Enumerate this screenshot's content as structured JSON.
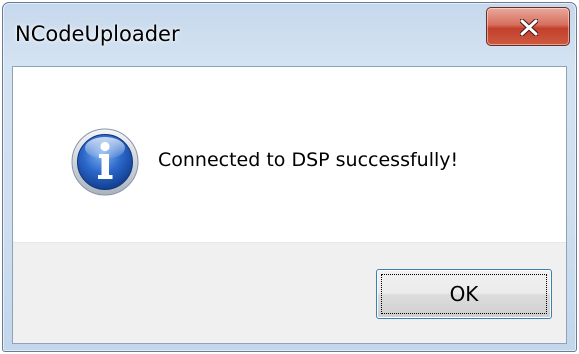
{
  "window": {
    "title": "NCodeUploader",
    "close_icon": "close-icon"
  },
  "dialog": {
    "icon": "info-icon",
    "message": "Connected to DSP successfully!"
  },
  "buttons": {
    "ok_label": "OK"
  },
  "colors": {
    "frame": "#c6d8ec",
    "close_button": "#c2402c",
    "info_icon": "#2060c8",
    "button_area": "#f0f0f0",
    "button_focus_border": "#3c7fb1"
  }
}
